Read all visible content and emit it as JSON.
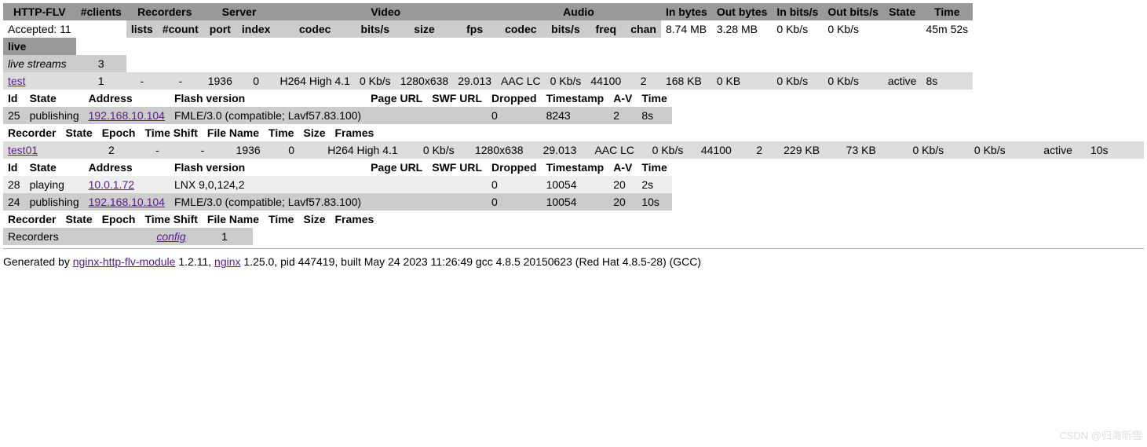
{
  "main_headers": {
    "r1": [
      "HTTP-FLV",
      "#clients",
      "Recorders",
      "Server",
      "Video",
      "Audio",
      "In bytes",
      "Out bytes",
      "In bits/s",
      "Out bits/s",
      "State",
      "Time"
    ],
    "accepted": "Accepted: 11",
    "r2": [
      "lists",
      "#count",
      "port",
      "index",
      "codec",
      "bits/s",
      "size",
      "fps",
      "codec",
      "bits/s",
      "freq",
      "chan"
    ],
    "totals": [
      "8.74 MB",
      "3.28 MB",
      "0 Kb/s",
      "0 Kb/s",
      "",
      "45m 52s"
    ]
  },
  "app_section": {
    "name": "live"
  },
  "live_streams_label": "live streams",
  "live_streams_count": "3",
  "streams": [
    {
      "name": "test",
      "clients": "1",
      "rec_lists": "-",
      "rec_count": "-",
      "port": "1936",
      "index": "0",
      "vcodec": "H264 High 4.1",
      "vbits": "0 Kb/s",
      "vsize": "1280x638",
      "fps": "29.013",
      "acodec": "AAC LC",
      "abits": "0 Kb/s",
      "freq": "44100",
      "chan": "2",
      "inb": "168 KB",
      "outb": "0 KB",
      "inbs": "0 Kb/s",
      "outbs": "0 Kb/s",
      "state": "active",
      "time": "8s",
      "clients_headers": [
        "Id",
        "State",
        "Address",
        "Flash version",
        "Page URL",
        "SWF URL",
        "Dropped",
        "Timestamp",
        "A-V",
        "Time"
      ],
      "client_rows": [
        {
          "id": "25",
          "state": "publishing",
          "addr": "192.168.10.104",
          "flash": "FMLE/3.0 (compatible; Lavf57.83.100)",
          "page": "",
          "swf": "",
          "drop": "0",
          "ts": "8243",
          "av": "2",
          "time": "8s"
        }
      ],
      "rec_headers": [
        "Recorder",
        "State",
        "Epoch",
        "Time Shift",
        "File Name",
        "Time",
        "Size",
        "Frames"
      ]
    },
    {
      "name": "test01",
      "clients": "2",
      "rec_lists": "-",
      "rec_count": "-",
      "port": "1936",
      "index": "0",
      "vcodec": "H264 High 4.1",
      "vbits": "0 Kb/s",
      "vsize": "1280x638",
      "fps": "29.013",
      "acodec": "AAC LC",
      "abits": "0 Kb/s",
      "freq": "44100",
      "chan": "2",
      "inb": "229 KB",
      "outb": "73 KB",
      "inbs": "0 Kb/s",
      "outbs": "0 Kb/s",
      "state": "active",
      "time": "10s",
      "clients_headers": [
        "Id",
        "State",
        "Address",
        "Flash version",
        "Page URL",
        "SWF URL",
        "Dropped",
        "Timestamp",
        "A-V",
        "Time"
      ],
      "client_rows": [
        {
          "id": "28",
          "state": "playing",
          "addr": "10.0.1.72",
          "flash": "LNX 9,0,124,2",
          "page": "",
          "swf": "",
          "drop": "0",
          "ts": "10054",
          "av": "20",
          "time": "2s"
        },
        {
          "id": "24",
          "state": "publishing",
          "addr": "192.168.10.104",
          "flash": "FMLE/3.0 (compatible; Lavf57.83.100)",
          "page": "",
          "swf": "",
          "drop": "0",
          "ts": "10054",
          "av": "20",
          "time": "10s"
        }
      ],
      "rec_headers": [
        "Recorder",
        "State",
        "Epoch",
        "Time Shift",
        "File Name",
        "Time",
        "Size",
        "Frames"
      ]
    }
  ],
  "recorders_section": {
    "label": "Recorders",
    "config": "config",
    "count": "1"
  },
  "footer": {
    "prefix": "Generated by ",
    "module": "nginx-http-flv-module",
    "module_ver": " 1.2.11, ",
    "nginx": "nginx",
    "rest": " 1.25.0, pid 447419, built May 24 2023 11:26:49 gcc 4.8.5 20150623 (Red Hat 4.8.5-28) (GCC)"
  },
  "watermark": "CSDN @归海昕雪"
}
